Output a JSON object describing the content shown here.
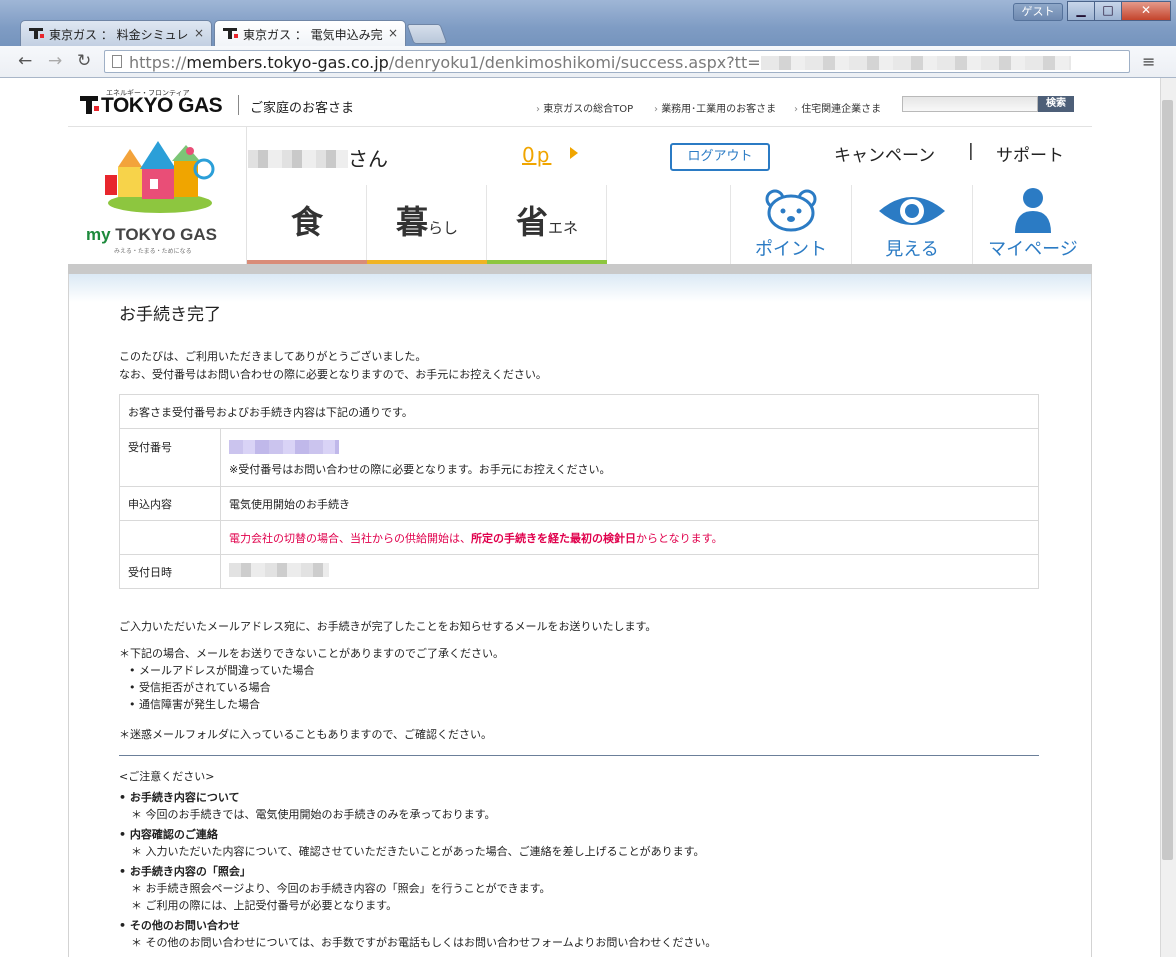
{
  "browser": {
    "tabs": [
      {
        "label": "東京ガス ： 料金シミュレ",
        "close": "×"
      },
      {
        "label": "東京ガス ： 電気申込み完",
        "close": "×"
      }
    ],
    "guest_label": "ゲスト",
    "url": {
      "scheme": "https://",
      "host": "members.tokyo-gas.co.jp",
      "path": "/denryoku1/denkimoshikomi/success.aspx?tt="
    }
  },
  "header": {
    "logo_text": "TOKYO GAS",
    "logo_sub": "エネルギー・フロンティア",
    "home_label": "ご家庭のお客さま",
    "links": [
      "東京ガスの総合TOP",
      "業務用･工業用のお客さま",
      "住宅関連企業さま"
    ],
    "search_button": "検索",
    "mytg_my": "my",
    "mytg_rest": " TOKYO GAS",
    "mytg_tag": "みえる・たまる・ためになる",
    "user_suffix": "さん",
    "points": "0p",
    "logout": "ログアウト",
    "campaign": "キャンペーン",
    "pipe": "|",
    "support": "サポート",
    "nav": [
      {
        "big": "食",
        "small": "",
        "color": "#d98c78"
      },
      {
        "big": "暮",
        "small": "らし",
        "color": "#f0b323"
      },
      {
        "big": "省",
        "small": "エネ",
        "color": "#8dc63f"
      }
    ],
    "icon_nav": [
      "ポイント",
      "見える",
      "マイページ"
    ]
  },
  "main": {
    "title": "お手続き完了",
    "intro": [
      "このたびは、ご利用いただきましてありがとうございました。",
      "なお、受付番号はお問い合わせの際に必要となりますので、お手元にお控えください。"
    ],
    "table": {
      "caption": "お客さま受付番号およびお手続き内容は下記の通りです。",
      "receipt_label": "受付番号",
      "receipt_note": "※受付番号はお問い合わせの際に必要となります。お手元にお控えください。",
      "content_label": "申込内容",
      "content_value": "電気使用開始のお手続き",
      "notice_pre": "電力会社の切替の場合、当社からの供給開始は、",
      "notice_bold": "所定の手続きを経た最初の検針日",
      "notice_post": "からとなります。",
      "date_label": "受付日時"
    },
    "mail_text": "ご入力いただいたメールアドレス宛に、お手続きが完了したことをお知らせするメールをお送りいたします。",
    "cases_head": "＊下記の場合、メールをお送りできないことがありますのでご了承ください。",
    "cases": [
      "メールアドレスが間違っていた場合",
      "受信拒否がされている場合",
      "通信障害が発生した場合"
    ],
    "spam_note": "＊迷惑メールフォルダに入っていることもありますので、ご確認ください。",
    "caution_title": "<ご注意ください>",
    "cautions": [
      {
        "head": "お手続き内容について",
        "lines": [
          "＊ 今回のお手続きでは、電気使用開始のお手続きのみを承っております。"
        ]
      },
      {
        "head": "内容確認のご連絡",
        "lines": [
          "＊ 入力いただいた内容について、確認させていただきたいことがあった場合、ご連絡を差し上げることがあります。"
        ]
      },
      {
        "head": "お手続き内容の「照会」",
        "lines": [
          "＊ お手続き照会ページより、今回のお手続き内容の「照会」を行うことができます。",
          "＊ ご利用の際には、上記受付番号が必要となります。"
        ]
      },
      {
        "head": "その他のお問い合わせ",
        "lines": [
          "＊ その他のお問い合わせについては、お手数ですがお電話もしくはお問い合わせフォームよりお問い合わせください。"
        ]
      }
    ]
  }
}
